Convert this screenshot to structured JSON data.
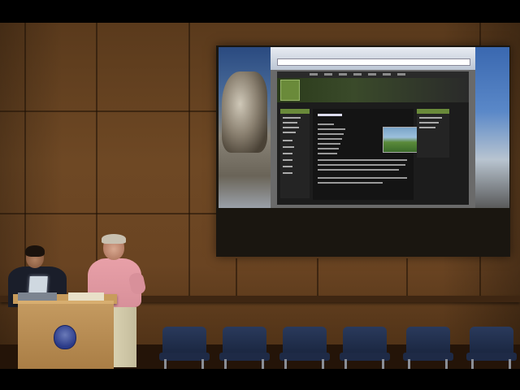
{
  "scene": {
    "description_colors": {
      "wall": "#6e4824",
      "podium": "#c49a60",
      "chairs": "#2a3a5c",
      "speaker_shirt": "#e8a0a8"
    }
  },
  "projection": {
    "content": "website-screenshot"
  },
  "chairs": [
    1,
    2,
    3,
    4,
    5,
    6
  ]
}
